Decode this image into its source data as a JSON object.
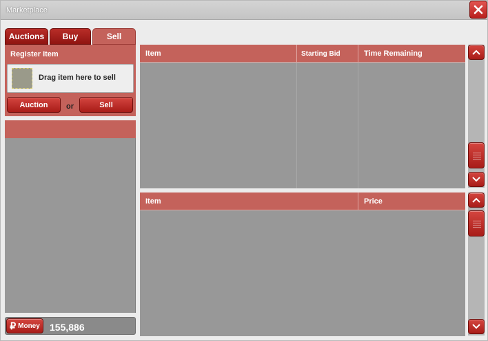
{
  "window": {
    "title": "Marketplace"
  },
  "tabs": [
    {
      "label": "Auctions",
      "active": false
    },
    {
      "label": "Buy",
      "active": false
    },
    {
      "label": "Sell",
      "active": true
    }
  ],
  "register": {
    "title": "Register Item",
    "drop_text": "Drag item here to sell",
    "auction_button": "Auction",
    "or_text": "or",
    "sell_button": "Sell"
  },
  "money": {
    "label": "Money",
    "icon": "ruble-icon",
    "value": "155,886"
  },
  "auction_table": {
    "columns": [
      "Item",
      "Starting Bid",
      "Time Remaining"
    ],
    "rows": []
  },
  "sell_table": {
    "columns": [
      "Item",
      "Price"
    ],
    "rows": []
  },
  "colors": {
    "accent": "#c4625b",
    "button_red": "#b81f1c",
    "panel_gray": "#989898"
  }
}
